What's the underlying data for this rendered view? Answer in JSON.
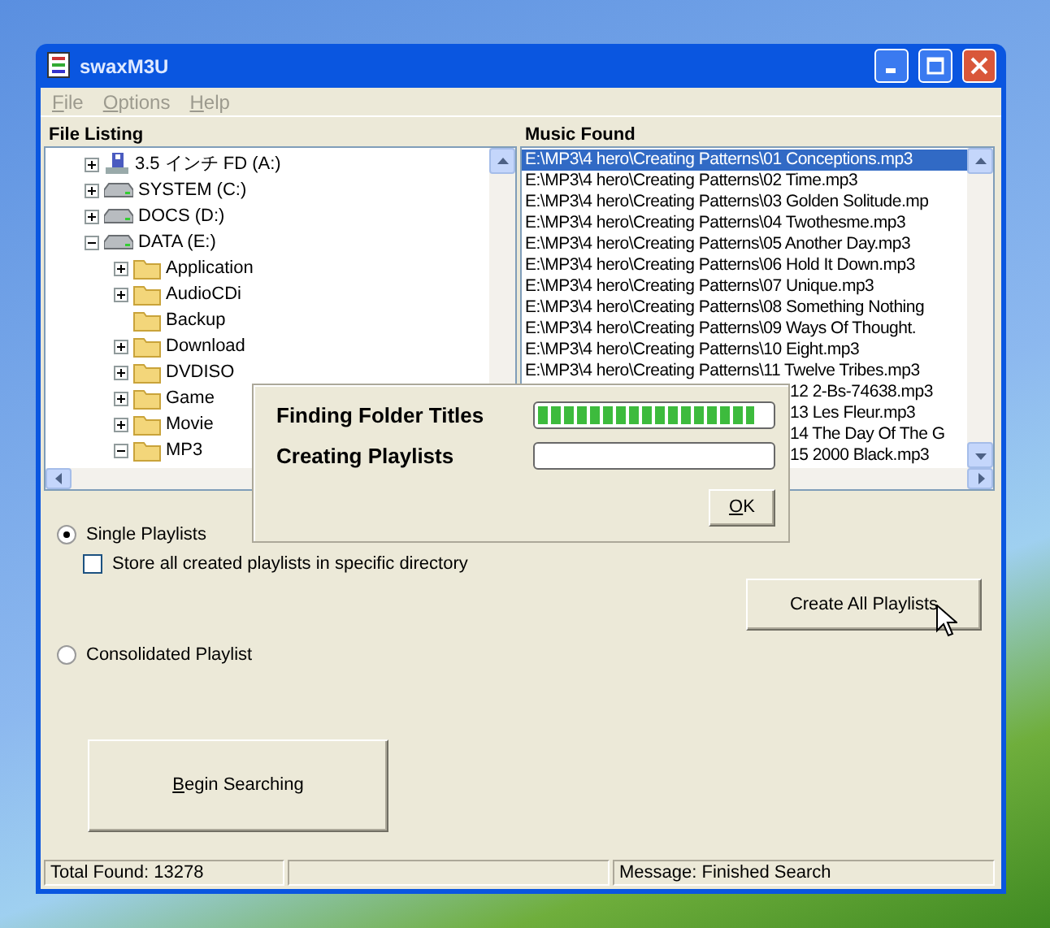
{
  "window": {
    "title": "swaxM3U"
  },
  "menu": [
    "File",
    "Options",
    "Help"
  ],
  "file_listing": {
    "title": "File Listing",
    "tree": [
      {
        "label": "3.5 インチ FD (A:)",
        "kind": "floppy",
        "expanded": false
      },
      {
        "label": "SYSTEM (C:)",
        "kind": "drive",
        "expanded": false
      },
      {
        "label": "DOCS (D:)",
        "kind": "drive",
        "expanded": false
      },
      {
        "label": "DATA (E:)",
        "kind": "drive",
        "expanded": true,
        "children": [
          {
            "label": "Application",
            "kind": "folder",
            "expanded": false
          },
          {
            "label": "AudioCDi",
            "kind": "folder",
            "expanded": false
          },
          {
            "label": "Backup",
            "kind": "folder"
          },
          {
            "label": "Download",
            "kind": "folder",
            "expanded": false
          },
          {
            "label": "DVDISO",
            "kind": "folder",
            "expanded": false
          },
          {
            "label": "Game",
            "kind": "folder",
            "expanded": false
          },
          {
            "label": "Movie",
            "kind": "folder",
            "expanded": false
          },
          {
            "label": "MP3",
            "kind": "folder",
            "expanded": true
          }
        ]
      }
    ]
  },
  "music_found": {
    "title": "Music Found",
    "items": [
      {
        "text": "E:\\MP3\\4 hero\\Creating Patterns\\01 Conceptions.mp3",
        "kind": "full",
        "selected": true
      },
      {
        "text": "E:\\MP3\\4 hero\\Creating Patterns\\02 Time.mp3",
        "kind": "full",
        "selected": false
      },
      {
        "text": "E:\\MP3\\4 hero\\Creating Patterns\\03 Golden Solitude.mp",
        "kind": "full",
        "selected": false
      },
      {
        "text": "E:\\MP3\\4 hero\\Creating Patterns\\04 Twothesme.mp3",
        "kind": "full",
        "selected": false
      },
      {
        "text": "E:\\MP3\\4 hero\\Creating Patterns\\05 Another Day.mp3",
        "kind": "full",
        "selected": false
      },
      {
        "text": "E:\\MP3\\4 hero\\Creating Patterns\\06 Hold It Down.mp3",
        "kind": "full",
        "selected": false
      },
      {
        "text": "E:\\MP3\\4 hero\\Creating Patterns\\07 Unique.mp3",
        "kind": "full",
        "selected": false
      },
      {
        "text": "E:\\MP3\\4 hero\\Creating Patterns\\08 Something Nothing",
        "kind": "full",
        "selected": false
      },
      {
        "text": "E:\\MP3\\4 hero\\Creating Patterns\\09 Ways Of Thought.",
        "kind": "full",
        "selected": false
      },
      {
        "text": "E:\\MP3\\4 hero\\Creating Patterns\\10 Eight.mp3",
        "kind": "full",
        "selected": false
      },
      {
        "text": "E:\\MP3\\4 hero\\Creating Patterns\\11 Twelve Tribes.mp3",
        "kind": "full",
        "selected": false
      },
      {
        "text": "12 2-Bs-74638.mp3",
        "kind": "partial",
        "selected": false
      },
      {
        "text": "13 Les Fleur.mp3",
        "kind": "partial",
        "selected": false
      },
      {
        "text": "14 The Day Of The G",
        "kind": "partial",
        "selected": false
      },
      {
        "text": "15 2000 Black.mp3",
        "kind": "partial",
        "selected": false
      }
    ]
  },
  "options": [
    {
      "label": "Single Playlists",
      "kind": "radio",
      "selected": true
    },
    {
      "label": "Store all created playlists in specific directory",
      "kind": "checkbox",
      "checked": false
    },
    {
      "label": "Consolidated Playlist",
      "kind": "radio",
      "selected": false
    }
  ],
  "create_button": "Create All Playlists",
  "begin_button": "Begin Searching",
  "status_bar": [
    "Total  Found: 13278",
    "Message: Finished Search"
  ],
  "progress_dialog": {
    "rows": [
      {
        "label": "Finding Folder Titles",
        "level": 0.93
      },
      {
        "label": "Creating Playlists",
        "level": 0
      }
    ],
    "ok_button": "OK"
  }
}
